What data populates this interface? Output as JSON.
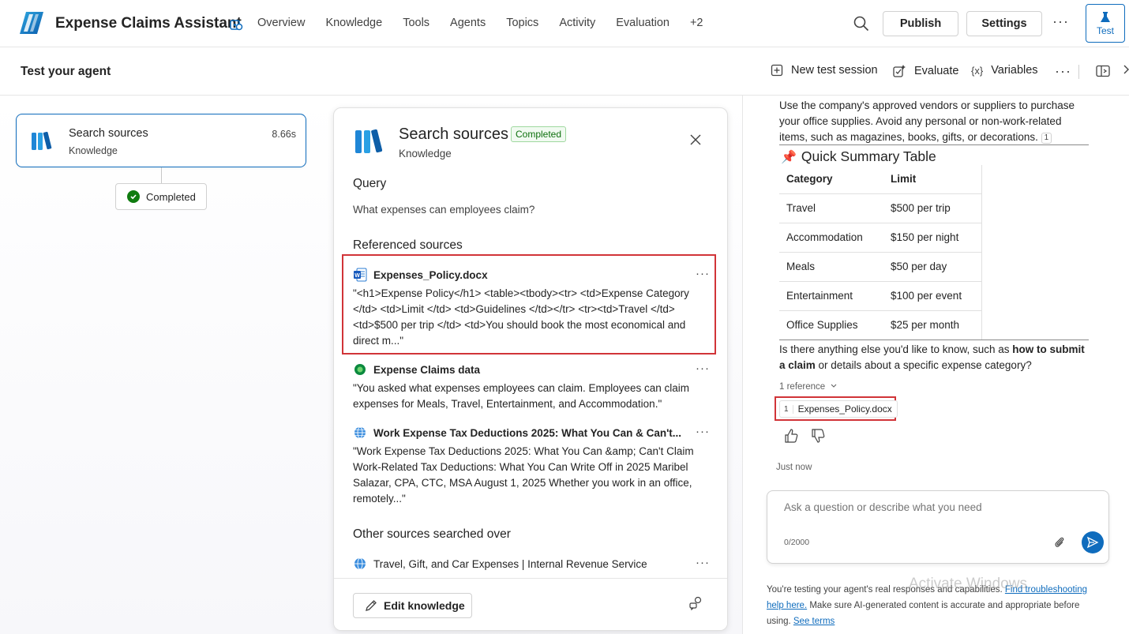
{
  "app": {
    "title": "Expense Claims Assistant",
    "nav": [
      "Overview",
      "Knowledge",
      "Tools",
      "Agents",
      "Topics",
      "Activity",
      "Evaluation",
      "+2"
    ],
    "publish_label": "Publish",
    "settings_label": "Settings",
    "more_label": "···",
    "test_label": "Test",
    "accent": "#0f6cbd"
  },
  "subbar": {
    "title": "Test your agent",
    "new_session": "New test session",
    "evaluate": "Evaluate",
    "variables": "Variables",
    "variables_icon": "{x}"
  },
  "canvas": {
    "node": {
      "title": "Search sources",
      "subtitle": "Knowledge",
      "duration": "8.66s"
    },
    "status": "Completed"
  },
  "detail": {
    "title": "Search sources",
    "status": "Completed",
    "subtitle": "Knowledge",
    "query_heading": "Query",
    "query": "What expenses can employees claim?",
    "referenced_heading": "Referenced sources",
    "references": [
      {
        "icon": "word-doc-icon",
        "title": "Expenses_Policy.docx",
        "snippet": "\"<h1>Expense Policy</h1> <table><tbody><tr> <td>Expense Category </td> <td>Limit </td> <td>Guidelines </td></tr> <tr><td>Travel </td> <td>$500 per trip </td> <td>You should book the most economical and direct m...\""
      },
      {
        "icon": "dataverse-icon",
        "title": "Expense Claims data",
        "snippet": "\"You asked what expenses employees can claim. Employees can claim expenses for Meals, Travel, Entertainment, and Accommodation.\""
      },
      {
        "icon": "globe-icon",
        "title": "Work Expense Tax Deductions 2025: What You Can & Can't...",
        "snippet": "\"Work Expense Tax Deductions 2025: What You Can &amp; Can't Claim Work-Related Tax Deductions: What You Can Write Off in 2025 Maribel Salazar, CPA, CTC, MSA August 1, 2025 Whether you work in an office, remotely...\""
      }
    ],
    "other_heading": "Other sources searched over",
    "other_sources": [
      {
        "icon": "globe-icon",
        "title": "Travel, Gift, and Car Expenses | Internal Revenue Service"
      }
    ],
    "edit_label": "Edit knowledge"
  },
  "chat": {
    "intro": "Use the company's approved vendors or suppliers to purchase your office supplies. Avoid any personal or non-work-related items, such as magazines, books, gifts, or decorations.",
    "intro_cite": "1",
    "summary_title": "Quick Summary Table",
    "table": {
      "headers": [
        "Category",
        "Limit"
      ],
      "rows": [
        [
          "Travel",
          "$500 per trip"
        ],
        [
          "Accommodation",
          "$150 per night"
        ],
        [
          "Meals",
          "$50 per day"
        ],
        [
          "Entertainment",
          "$100 per event"
        ],
        [
          "Office Supplies",
          "$25 per month"
        ]
      ]
    },
    "followup_pre": "Is there anything else you'd like to know, such as ",
    "followup_bold": "how to submit a claim",
    "followup_post": " or details about a specific expense category?",
    "references_toggle": "1 reference",
    "reference_chip": {
      "num": "1",
      "name": "Expenses_Policy.docx"
    },
    "timestamp": "Just now",
    "input_placeholder": "Ask a question or describe what you need",
    "char_counter": "0/2000",
    "disclaimer_pre": "You're testing your agent's real responses and capabilities. ",
    "disclaimer_link1": "Find troubleshooting help here.",
    "disclaimer_mid": " Make sure AI-generated content is accurate and appropriate before using. ",
    "disclaimer_link2": "See terms",
    "watermark": "Activate Windows"
  }
}
